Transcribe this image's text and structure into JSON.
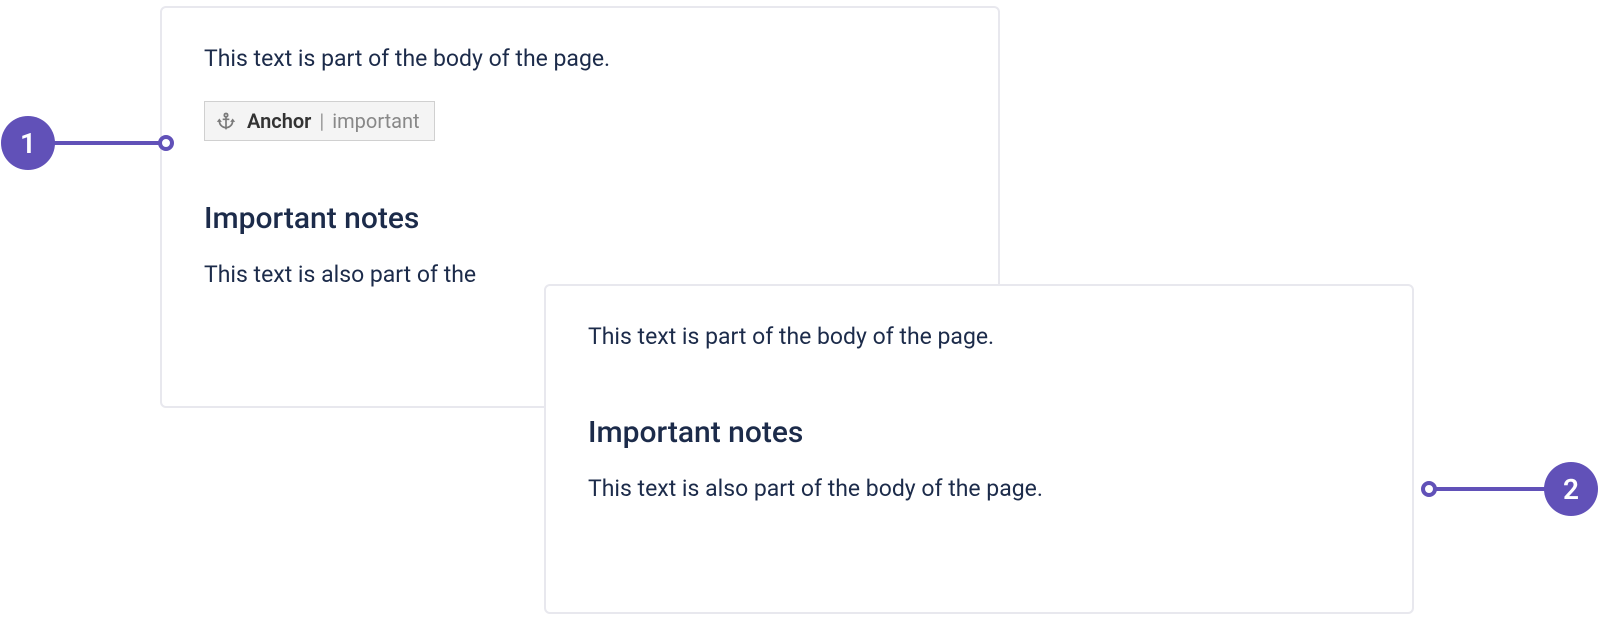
{
  "panel1": {
    "body_text_1": "This text is part of the body of the page.",
    "anchor": {
      "label": "Anchor",
      "separator": "|",
      "id": "important"
    },
    "heading": "Important notes",
    "body_text_2": "This text is also part of the"
  },
  "panel2": {
    "body_text_1": "This text is part of the body of the page.",
    "heading": "Important notes",
    "body_text_2": "This text is also part of the body of the page."
  },
  "callouts": {
    "one": "1",
    "two": "2"
  }
}
